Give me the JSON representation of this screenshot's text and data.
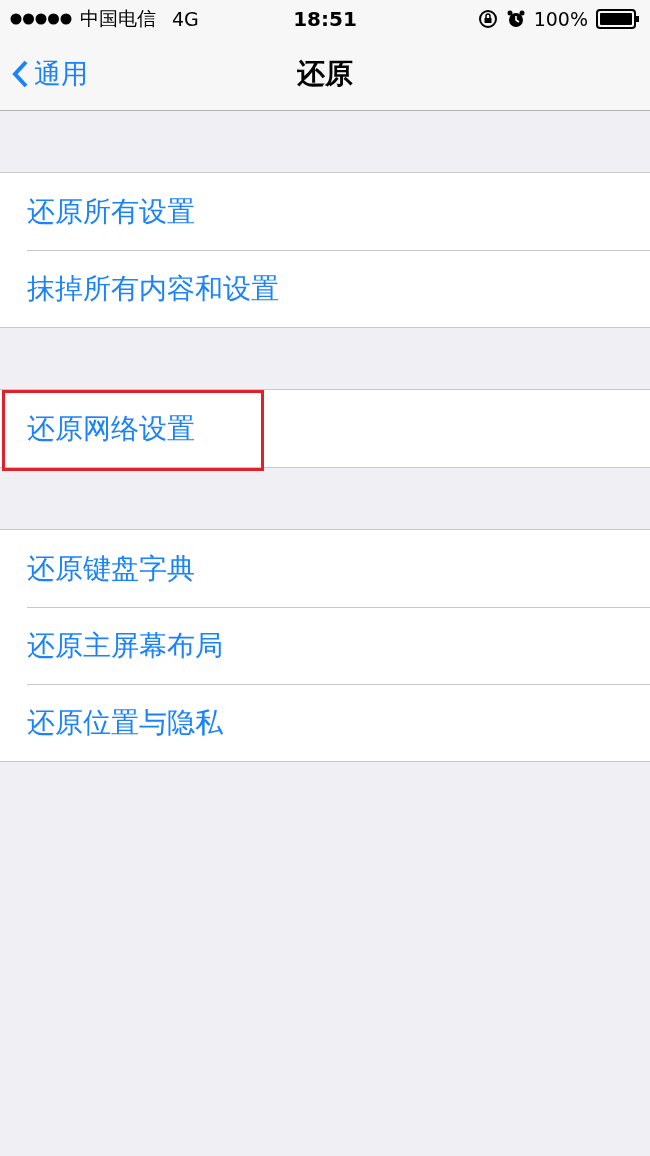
{
  "status_bar": {
    "carrier": "中国电信",
    "network": "4G",
    "time": "18:51",
    "battery": "100%"
  },
  "nav": {
    "back": "通用",
    "title": "还原"
  },
  "groups": [
    {
      "items": [
        {
          "label": "还原所有设置",
          "highlighted": false
        },
        {
          "label": "抹掉所有内容和设置",
          "highlighted": false
        }
      ]
    },
    {
      "items": [
        {
          "label": "还原网络设置",
          "highlighted": true
        }
      ]
    },
    {
      "items": [
        {
          "label": "还原键盘字典",
          "highlighted": false
        },
        {
          "label": "还原主屏幕布局",
          "highlighted": false
        },
        {
          "label": "还原位置与隐私",
          "highlighted": false
        }
      ]
    }
  ]
}
